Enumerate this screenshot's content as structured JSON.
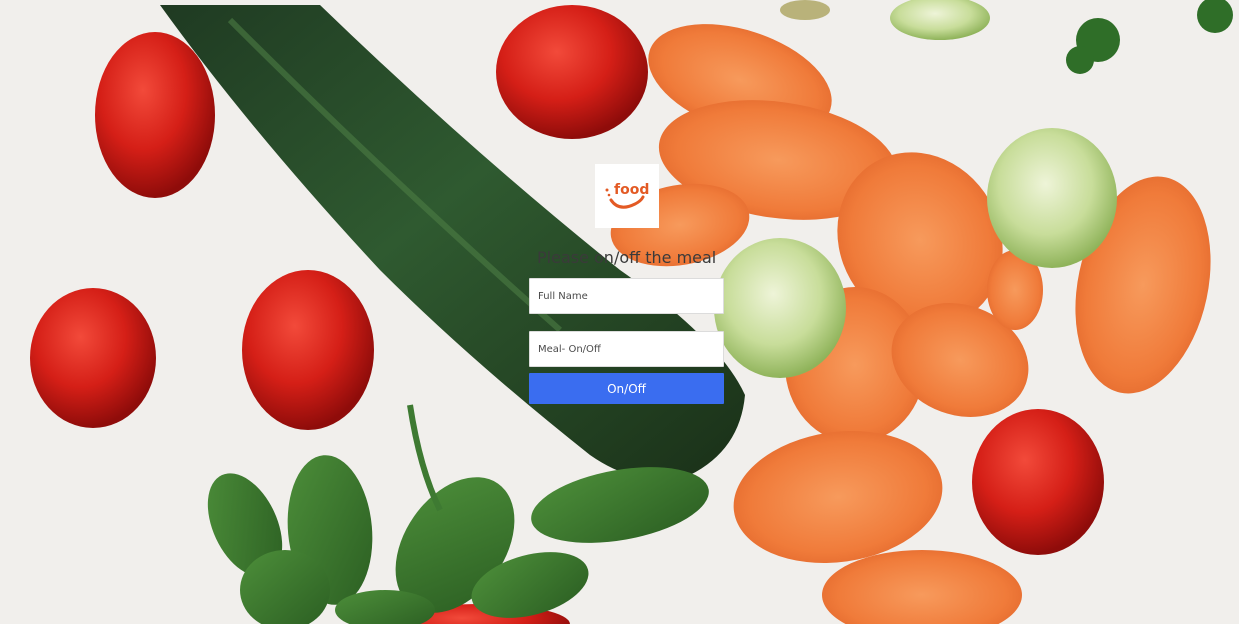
{
  "logo": {
    "text": "food",
    "icon": "food-brand-logo"
  },
  "form": {
    "title": "Please on/off the meal",
    "full_name_placeholder": "Full Name",
    "meal_placeholder": "Meal- On/Off",
    "submit_label": "On/Off"
  },
  "colors": {
    "accent": "#3a6df0",
    "brand": "#e35a24",
    "background": "#f1efec"
  }
}
